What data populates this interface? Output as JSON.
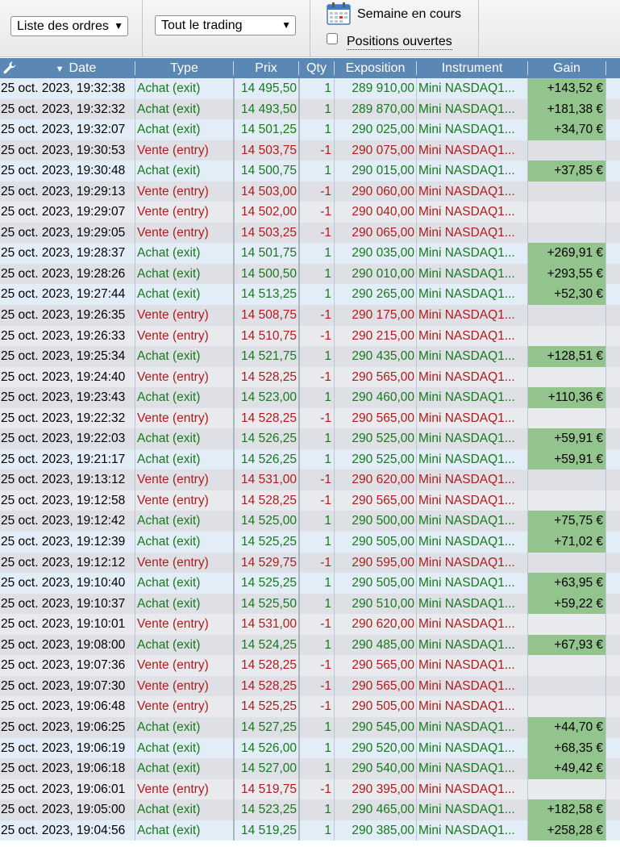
{
  "toolbar": {
    "order_list_select": "Liste des ordres",
    "trading_select": "Tout le trading",
    "week_label": "Semaine en cours",
    "open_positions_label": "Positions ouvertes",
    "open_positions_checked": false
  },
  "columns": {
    "date": "Date",
    "type": "Type",
    "prix": "Prix",
    "qty": "Qty",
    "exposition": "Exposition",
    "instrument": "Instrument",
    "gain": "Gain"
  },
  "colors": {
    "buy": "#157a1b",
    "sell": "#b01b1b",
    "header_bg": "#5b87b5",
    "gain_bg": "#93c48d"
  },
  "rows": [
    {
      "date": "25 oct. 2023, 19:32:38",
      "type": "Achat (exit)",
      "prix": "14 495,50",
      "qty": "1",
      "exposition": "289 910,00",
      "instrument": "Mini NASDAQ1...",
      "gain": "+143,52 €"
    },
    {
      "date": "25 oct. 2023, 19:32:32",
      "type": "Achat (exit)",
      "prix": "14 493,50",
      "qty": "1",
      "exposition": "289 870,00",
      "instrument": "Mini NASDAQ1...",
      "gain": "+181,38 €"
    },
    {
      "date": "25 oct. 2023, 19:32:07",
      "type": "Achat (exit)",
      "prix": "14 501,25",
      "qty": "1",
      "exposition": "290 025,00",
      "instrument": "Mini NASDAQ1...",
      "gain": "+34,70 €"
    },
    {
      "date": "25 oct. 2023, 19:30:53",
      "type": "Vente (entry)",
      "prix": "14 503,75",
      "qty": "-1",
      "exposition": "290 075,00",
      "instrument": "Mini NASDAQ1...",
      "gain": ""
    },
    {
      "date": "25 oct. 2023, 19:30:48",
      "type": "Achat (exit)",
      "prix": "14 500,75",
      "qty": "1",
      "exposition": "290 015,00",
      "instrument": "Mini NASDAQ1...",
      "gain": "+37,85 €"
    },
    {
      "date": "25 oct. 2023, 19:29:13",
      "type": "Vente (entry)",
      "prix": "14 503,00",
      "qty": "-1",
      "exposition": "290 060,00",
      "instrument": "Mini NASDAQ1...",
      "gain": ""
    },
    {
      "date": "25 oct. 2023, 19:29:07",
      "type": "Vente (entry)",
      "prix": "14 502,00",
      "qty": "-1",
      "exposition": "290 040,00",
      "instrument": "Mini NASDAQ1...",
      "gain": ""
    },
    {
      "date": "25 oct. 2023, 19:29:05",
      "type": "Vente (entry)",
      "prix": "14 503,25",
      "qty": "-1",
      "exposition": "290 065,00",
      "instrument": "Mini NASDAQ1...",
      "gain": ""
    },
    {
      "date": "25 oct. 2023, 19:28:37",
      "type": "Achat (exit)",
      "prix": "14 501,75",
      "qty": "1",
      "exposition": "290 035,00",
      "instrument": "Mini NASDAQ1...",
      "gain": "+269,91 €"
    },
    {
      "date": "25 oct. 2023, 19:28:26",
      "type": "Achat (exit)",
      "prix": "14 500,50",
      "qty": "1",
      "exposition": "290 010,00",
      "instrument": "Mini NASDAQ1...",
      "gain": "+293,55 €"
    },
    {
      "date": "25 oct. 2023, 19:27:44",
      "type": "Achat (exit)",
      "prix": "14 513,25",
      "qty": "1",
      "exposition": "290 265,00",
      "instrument": "Mini NASDAQ1...",
      "gain": "+52,30 €"
    },
    {
      "date": "25 oct. 2023, 19:26:35",
      "type": "Vente (entry)",
      "prix": "14 508,75",
      "qty": "-1",
      "exposition": "290 175,00",
      "instrument": "Mini NASDAQ1...",
      "gain": ""
    },
    {
      "date": "25 oct. 2023, 19:26:33",
      "type": "Vente (entry)",
      "prix": "14 510,75",
      "qty": "-1",
      "exposition": "290 215,00",
      "instrument": "Mini NASDAQ1...",
      "gain": ""
    },
    {
      "date": "25 oct. 2023, 19:25:34",
      "type": "Achat (exit)",
      "prix": "14 521,75",
      "qty": "1",
      "exposition": "290 435,00",
      "instrument": "Mini NASDAQ1...",
      "gain": "+128,51 €"
    },
    {
      "date": "25 oct. 2023, 19:24:40",
      "type": "Vente (entry)",
      "prix": "14 528,25",
      "qty": "-1",
      "exposition": "290 565,00",
      "instrument": "Mini NASDAQ1...",
      "gain": ""
    },
    {
      "date": "25 oct. 2023, 19:23:43",
      "type": "Achat (exit)",
      "prix": "14 523,00",
      "qty": "1",
      "exposition": "290 460,00",
      "instrument": "Mini NASDAQ1...",
      "gain": "+110,36 €"
    },
    {
      "date": "25 oct. 2023, 19:22:32",
      "type": "Vente (entry)",
      "prix": "14 528,25",
      "qty": "-1",
      "exposition": "290 565,00",
      "instrument": "Mini NASDAQ1...",
      "gain": ""
    },
    {
      "date": "25 oct. 2023, 19:22:03",
      "type": "Achat (exit)",
      "prix": "14 526,25",
      "qty": "1",
      "exposition": "290 525,00",
      "instrument": "Mini NASDAQ1...",
      "gain": "+59,91 €"
    },
    {
      "date": "25 oct. 2023, 19:21:17",
      "type": "Achat (exit)",
      "prix": "14 526,25",
      "qty": "1",
      "exposition": "290 525,00",
      "instrument": "Mini NASDAQ1...",
      "gain": "+59,91 €"
    },
    {
      "date": "25 oct. 2023, 19:13:12",
      "type": "Vente (entry)",
      "prix": "14 531,00",
      "qty": "-1",
      "exposition": "290 620,00",
      "instrument": "Mini NASDAQ1...",
      "gain": ""
    },
    {
      "date": "25 oct. 2023, 19:12:58",
      "type": "Vente (entry)",
      "prix": "14 528,25",
      "qty": "-1",
      "exposition": "290 565,00",
      "instrument": "Mini NASDAQ1...",
      "gain": ""
    },
    {
      "date": "25 oct. 2023, 19:12:42",
      "type": "Achat (exit)",
      "prix": "14 525,00",
      "qty": "1",
      "exposition": "290 500,00",
      "instrument": "Mini NASDAQ1...",
      "gain": "+75,75 €"
    },
    {
      "date": "25 oct. 2023, 19:12:39",
      "type": "Achat (exit)",
      "prix": "14 525,25",
      "qty": "1",
      "exposition": "290 505,00",
      "instrument": "Mini NASDAQ1...",
      "gain": "+71,02 €"
    },
    {
      "date": "25 oct. 2023, 19:12:12",
      "type": "Vente (entry)",
      "prix": "14 529,75",
      "qty": "-1",
      "exposition": "290 595,00",
      "instrument": "Mini NASDAQ1...",
      "gain": ""
    },
    {
      "date": "25 oct. 2023, 19:10:40",
      "type": "Achat (exit)",
      "prix": "14 525,25",
      "qty": "1",
      "exposition": "290 505,00",
      "instrument": "Mini NASDAQ1...",
      "gain": "+63,95 €"
    },
    {
      "date": "25 oct. 2023, 19:10:37",
      "type": "Achat (exit)",
      "prix": "14 525,50",
      "qty": "1",
      "exposition": "290 510,00",
      "instrument": "Mini NASDAQ1...",
      "gain": "+59,22 €"
    },
    {
      "date": "25 oct. 2023, 19:10:01",
      "type": "Vente (entry)",
      "prix": "14 531,00",
      "qty": "-1",
      "exposition": "290 620,00",
      "instrument": "Mini NASDAQ1...",
      "gain": ""
    },
    {
      "date": "25 oct. 2023, 19:08:00",
      "type": "Achat (exit)",
      "prix": "14 524,25",
      "qty": "1",
      "exposition": "290 485,00",
      "instrument": "Mini NASDAQ1...",
      "gain": "+67,93 €"
    },
    {
      "date": "25 oct. 2023, 19:07:36",
      "type": "Vente (entry)",
      "prix": "14 528,25",
      "qty": "-1",
      "exposition": "290 565,00",
      "instrument": "Mini NASDAQ1...",
      "gain": ""
    },
    {
      "date": "25 oct. 2023, 19:07:30",
      "type": "Vente (entry)",
      "prix": "14 528,25",
      "qty": "-1",
      "exposition": "290 565,00",
      "instrument": "Mini NASDAQ1...",
      "gain": ""
    },
    {
      "date": "25 oct. 2023, 19:06:48",
      "type": "Vente (entry)",
      "prix": "14 525,25",
      "qty": "-1",
      "exposition": "290 505,00",
      "instrument": "Mini NASDAQ1...",
      "gain": ""
    },
    {
      "date": "25 oct. 2023, 19:06:25",
      "type": "Achat (exit)",
      "prix": "14 527,25",
      "qty": "1",
      "exposition": "290 545,00",
      "instrument": "Mini NASDAQ1...",
      "gain": "+44,70 €"
    },
    {
      "date": "25 oct. 2023, 19:06:19",
      "type": "Achat (exit)",
      "prix": "14 526,00",
      "qty": "1",
      "exposition": "290 520,00",
      "instrument": "Mini NASDAQ1...",
      "gain": "+68,35 €"
    },
    {
      "date": "25 oct. 2023, 19:06:18",
      "type": "Achat (exit)",
      "prix": "14 527,00",
      "qty": "1",
      "exposition": "290 540,00",
      "instrument": "Mini NASDAQ1...",
      "gain": "+49,42 €"
    },
    {
      "date": "25 oct. 2023, 19:06:01",
      "type": "Vente (entry)",
      "prix": "14 519,75",
      "qty": "-1",
      "exposition": "290 395,00",
      "instrument": "Mini NASDAQ1...",
      "gain": ""
    },
    {
      "date": "25 oct. 2023, 19:05:00",
      "type": "Achat (exit)",
      "prix": "14 523,25",
      "qty": "1",
      "exposition": "290 465,00",
      "instrument": "Mini NASDAQ1...",
      "gain": "+182,58 €"
    },
    {
      "date": "25 oct. 2023, 19:04:56",
      "type": "Achat (exit)",
      "prix": "14 519,25",
      "qty": "1",
      "exposition": "290 385,00",
      "instrument": "Mini NASDAQ1...",
      "gain": "+258,28 €"
    }
  ]
}
